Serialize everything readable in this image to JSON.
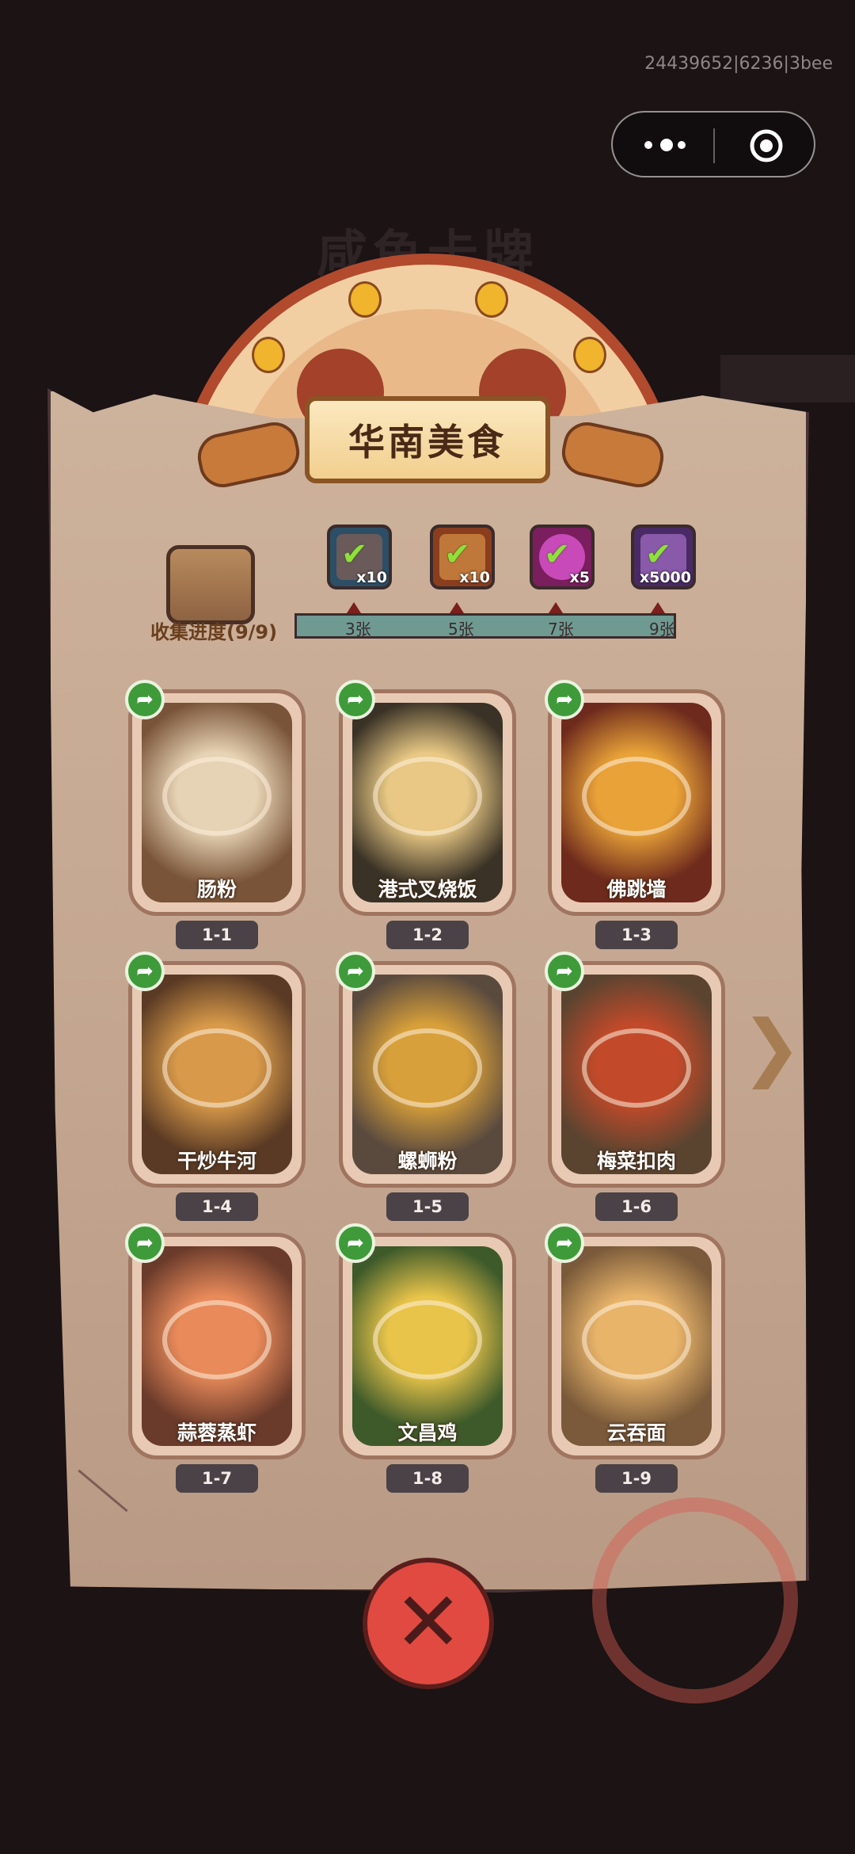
{
  "debug_id": "24439652|6236|3bee",
  "background": {
    "title": "咸鱼卡牌"
  },
  "capsule": {
    "more_icon": "more-dots-icon",
    "close_icon": "target-circle-icon"
  },
  "banner": {
    "title": "华南美食"
  },
  "progress": {
    "label": "收集进度(9/9)",
    "collected": 9,
    "total": 9
  },
  "rewards": [
    {
      "icon": "treasure-chest-icon",
      "count": "x10",
      "threshold": "3张",
      "claimed": true,
      "color": "#3f6e8a"
    },
    {
      "icon": "key-scroll-icon",
      "count": "x10",
      "threshold": "5张",
      "claimed": true,
      "color": "#b2622f"
    },
    {
      "icon": "magic-orb-icon",
      "count": "x5",
      "threshold": "7张",
      "claimed": true,
      "color": "#b63fa0"
    },
    {
      "icon": "silver-ingot-icon",
      "count": "x5000",
      "threshold": "9张",
      "claimed": true,
      "color": "#6a3a8a"
    }
  ],
  "cards": [
    {
      "name": "肠粉",
      "tag": "1-1",
      "palette": [
        "#7a5438",
        "#e6d2b4"
      ]
    },
    {
      "name": "港式叉烧饭",
      "tag": "1-2",
      "palette": [
        "#3a3226",
        "#e8c884"
      ]
    },
    {
      "name": "佛跳墙",
      "tag": "1-3",
      "palette": [
        "#6e2a1c",
        "#e8a238"
      ]
    },
    {
      "name": "干炒牛河",
      "tag": "1-4",
      "palette": [
        "#5a3a24",
        "#d89a4a"
      ]
    },
    {
      "name": "螺蛳粉",
      "tag": "1-5",
      "palette": [
        "#5a4a3e",
        "#d8a03a"
      ]
    },
    {
      "name": "梅菜扣肉",
      "tag": "1-6",
      "palette": [
        "#5a4430",
        "#c24a2a"
      ]
    },
    {
      "name": "蒜蓉蒸虾",
      "tag": "1-7",
      "palette": [
        "#6a3a2a",
        "#e88a5a"
      ]
    },
    {
      "name": "文昌鸡",
      "tag": "1-8",
      "palette": [
        "#3e5a2a",
        "#e8c44a"
      ]
    },
    {
      "name": "云吞面",
      "tag": "1-9",
      "palette": [
        "#7a5a3a",
        "#e8b46a"
      ]
    }
  ],
  "share_icon": "share-arrow-icon",
  "next_icon": "next-page-arrow-icon",
  "close_button": {
    "icon": "close-x-icon",
    "label": "✕"
  }
}
